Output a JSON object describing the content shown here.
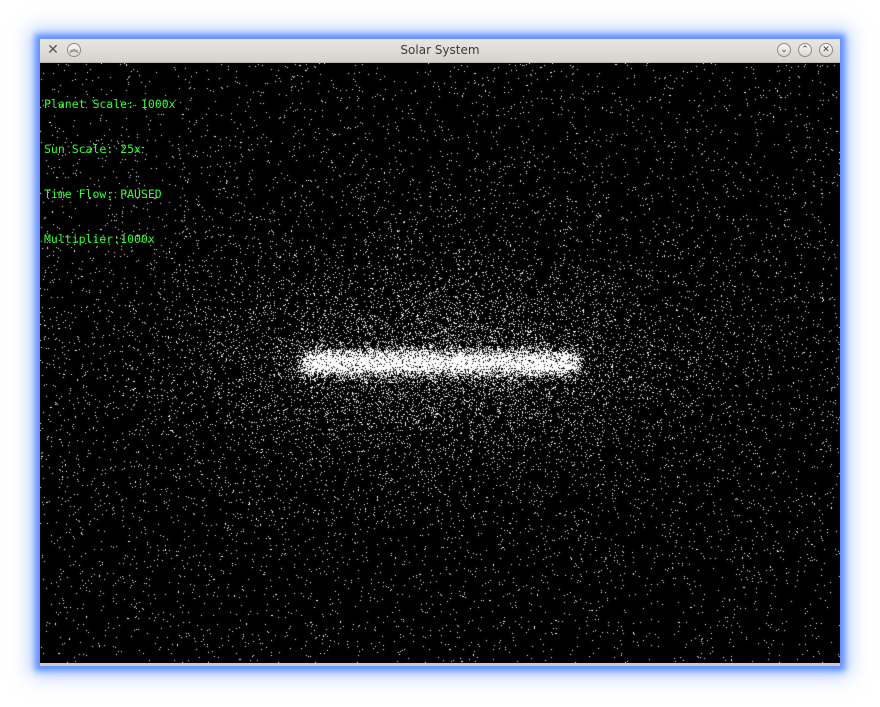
{
  "window": {
    "title": "Solar System",
    "accent_glow": "#5a8cff"
  },
  "titlebar": {
    "app_icon": "tools-icon",
    "left_buttons": [
      "shade-icon"
    ],
    "right_buttons": [
      "minimize-icon",
      "maximize-icon",
      "close-icon"
    ]
  },
  "hud": {
    "color": "#33ff33",
    "lines": [
      "Planet Scale: 1000x",
      "Sun Scale: 25x",
      "Time Flow: PAUSED",
      "Multiplier:1000x"
    ]
  },
  "scene": {
    "background": "#000000",
    "particle_color": "#ffffff"
  }
}
